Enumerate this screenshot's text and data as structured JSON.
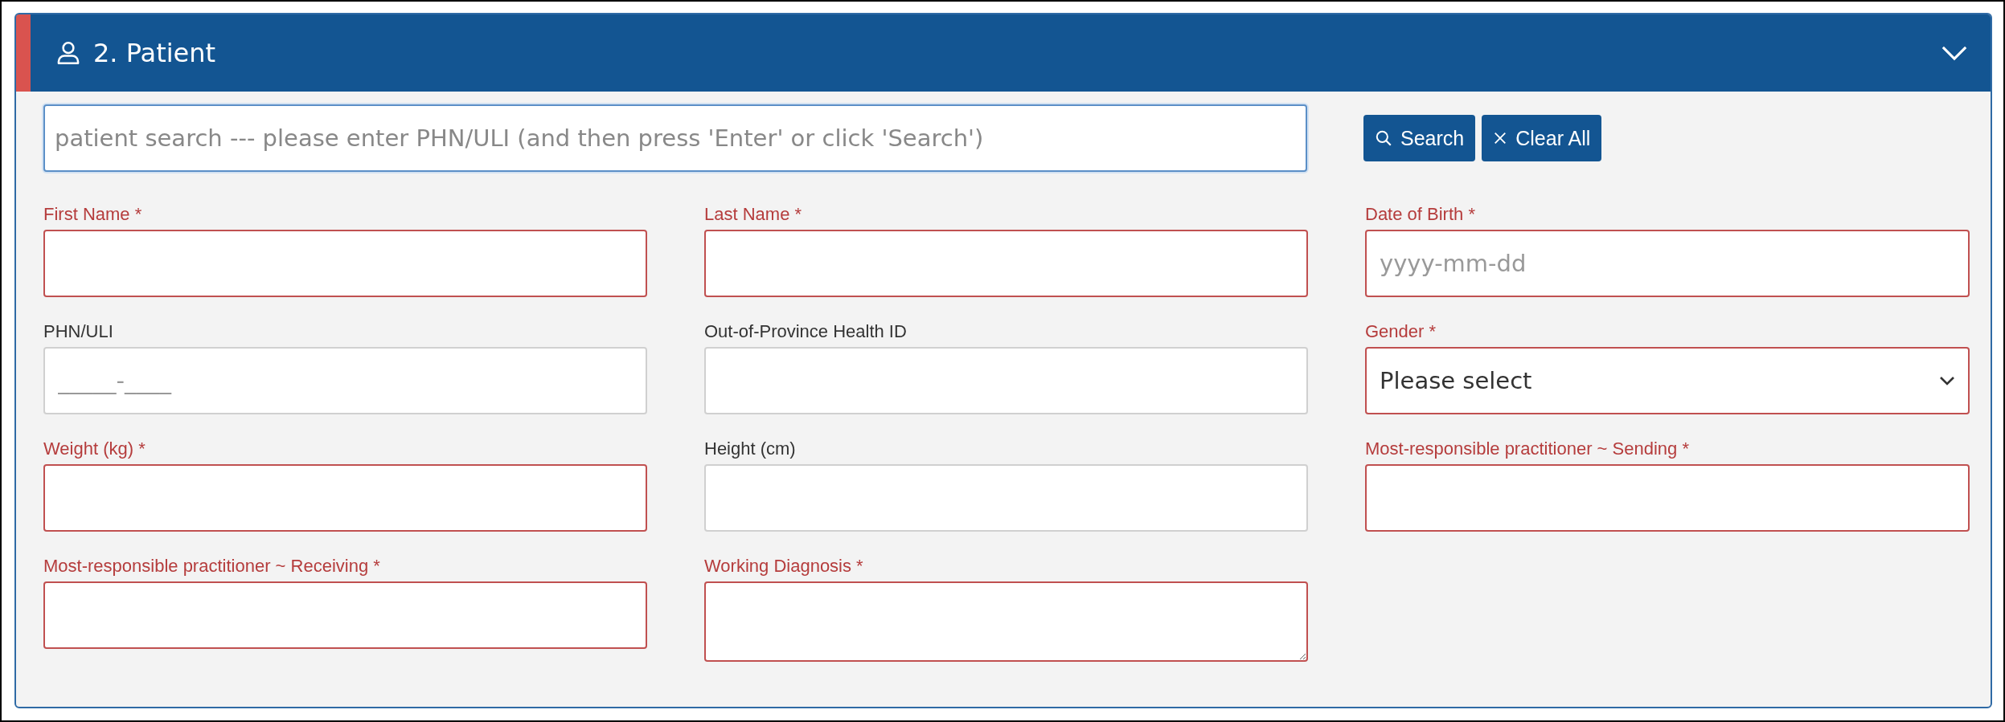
{
  "panel": {
    "title": "2. Patient",
    "expanded": true
  },
  "search": {
    "placeholder": "patient search --- please enter PHN/ULI (and then press 'Enter' or click 'Search')",
    "focused": true
  },
  "buttons": [
    {
      "kind": "search",
      "label": "Search"
    },
    {
      "kind": "clear",
      "label": "Clear All"
    }
  ],
  "fields": [
    {
      "label": "First Name *",
      "kind": "text",
      "required": true
    },
    {
      "label": "Last Name *",
      "kind": "text",
      "required": true
    },
    {
      "label": "Date of Birth *",
      "kind": "text",
      "required": true,
      "placeholder": "yyyy-mm-dd"
    },
    {
      "label": "PHN/ULI",
      "kind": "text",
      "required": false,
      "placeholder": "_____-____"
    },
    {
      "label": "Out-of-Province Health ID",
      "kind": "text",
      "required": false
    },
    {
      "label": "Gender *",
      "kind": "select",
      "required": true,
      "value": "Please select"
    },
    {
      "label": "Weight (kg) *",
      "kind": "text",
      "required": true
    },
    {
      "label": "Height (cm)",
      "kind": "text",
      "required": false
    },
    {
      "label": "Most-responsible practitioner ~ Sending *",
      "kind": "text",
      "required": true
    },
    {
      "label": "Most-responsible practitioner ~ Receiving *",
      "kind": "text",
      "required": true
    },
    {
      "label": "Working Diagnosis *",
      "kind": "textarea",
      "required": true
    }
  ]
}
